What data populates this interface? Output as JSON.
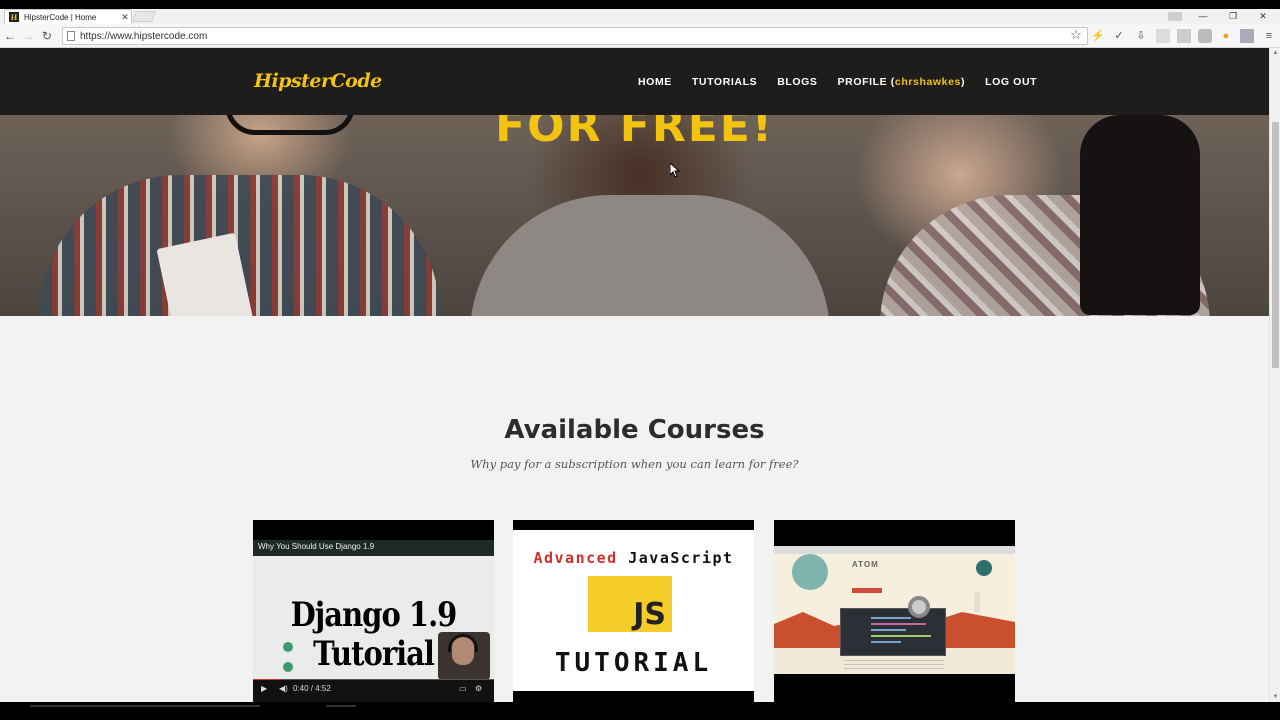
{
  "browser": {
    "tab_title": "HipsterCode | Home",
    "favicon_letter": "H",
    "tab_close": "✕",
    "url": "https://www.hipstercode.com",
    "back": "←",
    "forward": "→",
    "reload": "↻",
    "bookmark_star": "☆",
    "minimize": "—",
    "restore": "❐",
    "close": "✕"
  },
  "site": {
    "logo": "HipsterCode",
    "nav": {
      "home": "HOME",
      "tutorials": "TUTORIALS",
      "blogs": "BLOGS",
      "profile_prefix": "PROFILE (",
      "profile_user": "chrshawkes",
      "profile_suffix": ")",
      "logout": "LOG OUT"
    }
  },
  "hero": {
    "headline": "FOR FREE!"
  },
  "courses": {
    "title": "Available Courses",
    "subtitle": "Why pay for a subscription when you can learn for free?",
    "cards": [
      {
        "video_title": "Why You Should Use Django 1.9",
        "big_text": "Django 1.9 Tutorial",
        "time": "0:40 / 4:52"
      },
      {
        "line1_a": "Advanced",
        "line1_b": "JavaScript",
        "logo": "JS",
        "line3": "TUTORIAL"
      },
      {
        "logo_text": "ATOM"
      }
    ]
  },
  "colors": {
    "accent": "#f3c312",
    "nav_bg": "#1e1d1b",
    "js_red": "#d0302b",
    "js_yellow": "#f4cd2a"
  }
}
